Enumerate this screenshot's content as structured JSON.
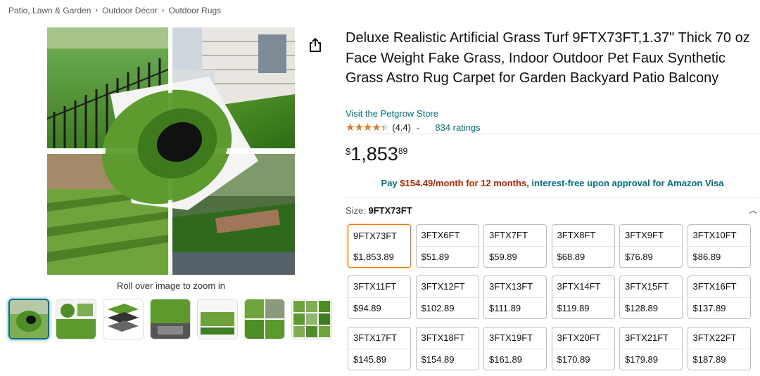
{
  "breadcrumb": [
    "Patio, Lawn & Garden",
    "Outdoor Décor",
    "Outdoor Rugs"
  ],
  "breadcrumb_separator": "›",
  "gallery": {
    "zoom_hint": "Roll over image to zoom in",
    "thumbnail_count": 7,
    "active_thumbnail": 0
  },
  "product": {
    "title": "Deluxe Realistic Artificial Grass Turf 9FTX73FT,1.37\" Thick 70 oz Face Weight Fake Grass, Indoor Outdoor Pet Faux Synthetic Grass Astro Rug Carpet for Garden Backyard Patio Balcony",
    "store_link": "Visit the Petgrow Store",
    "rating_value": "(4.4)",
    "rating_stars": 4.4,
    "ratings_count": "834 ratings"
  },
  "price": {
    "symbol": "$",
    "whole": "1,853",
    "fraction": "89"
  },
  "finance": {
    "prefix": "Pay ",
    "amount": "$154.49/month for 12 months",
    "suffix": ", interest-free upon approval for Amazon Visa"
  },
  "size": {
    "label": "Size: ",
    "selected": "9FTX73FT",
    "options": [
      {
        "name": "9FTX73FT",
        "price": "$1,853.89"
      },
      {
        "name": "3FTX6FT",
        "price": "$51.89"
      },
      {
        "name": "3FTX7FT",
        "price": "$59.89"
      },
      {
        "name": "3FTX8FT",
        "price": "$68.89"
      },
      {
        "name": "3FTX9FT",
        "price": "$76.89"
      },
      {
        "name": "3FTX10FT",
        "price": "$86.89"
      },
      {
        "name": "3FTX11FT",
        "price": "$94.89"
      },
      {
        "name": "3FTX12FT",
        "price": "$102.89"
      },
      {
        "name": "3FTX13FT",
        "price": "$111.89"
      },
      {
        "name": "3FTX14FT",
        "price": "$119.89"
      },
      {
        "name": "3FTX15FT",
        "price": "$128.89"
      },
      {
        "name": "3FTX16FT",
        "price": "$137.89"
      },
      {
        "name": "3FTX17FT",
        "price": "$145.89"
      },
      {
        "name": "3FTX18FT",
        "price": "$154.89"
      },
      {
        "name": "3FTX19FT",
        "price": "$161.89"
      },
      {
        "name": "3FTX20FT",
        "price": "$170.89"
      },
      {
        "name": "3FTX21FT",
        "price": "$179.89"
      },
      {
        "name": "3FTX22FT",
        "price": "$187.89"
      }
    ]
  },
  "colors": {
    "link": "#007185",
    "price_red": "#b12704",
    "star": "#de7921",
    "selected_border": "#e77600"
  }
}
